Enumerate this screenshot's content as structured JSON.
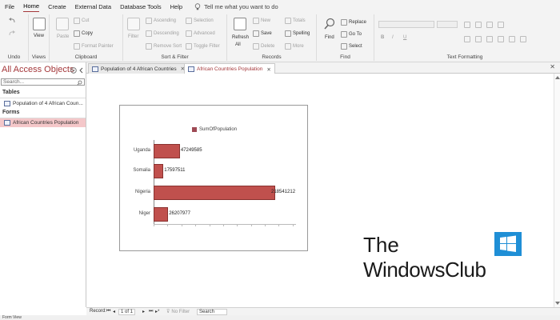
{
  "menu": {
    "tabs": [
      "File",
      "Home",
      "Create",
      "External Data",
      "Database Tools",
      "Help"
    ],
    "active": "Home",
    "tell_me": "Tell me what you want to do"
  },
  "ribbon": {
    "undo": {
      "label": "Undo"
    },
    "views": {
      "label": "Views",
      "view": "View"
    },
    "clipboard": {
      "label": "Clipboard",
      "paste": "Paste",
      "cut": "Cut",
      "copy": "Copy",
      "format_painter": "Format Painter"
    },
    "sort_filter": {
      "label": "Sort & Filter",
      "filter": "Filter",
      "ascending": "Ascending",
      "descending": "Descending",
      "remove_sort": "Remove Sort",
      "selection": "Selection",
      "advanced": "Advanced",
      "toggle_filter": "Toggle Filter"
    },
    "records": {
      "label": "Records",
      "refresh": "Refresh",
      "all": "All",
      "new": "New",
      "save": "Save",
      "delete": "Delete",
      "totals": "Totals",
      "spelling": "Spelling",
      "more": "More"
    },
    "find": {
      "label": "Find",
      "find": "Find",
      "replace": "Replace",
      "goto": "Go To",
      "select": "Select"
    },
    "text_formatting": {
      "label": "Text Formatting",
      "bold": "B",
      "italic": "I",
      "underline": "U"
    }
  },
  "nav": {
    "title": "All Access Objects",
    "search_placeholder": "Search...",
    "sections": [
      {
        "name": "Tables",
        "items": [
          "Population of 4 African Coun..."
        ]
      },
      {
        "name": "Forms",
        "items": [
          "African Countries Population"
        ]
      }
    ]
  },
  "doc_tabs": [
    {
      "label": "Population of 4 African Countries",
      "active": false
    },
    {
      "label": "African Countries Population",
      "active": true
    }
  ],
  "chart_data": {
    "type": "bar",
    "orientation": "horizontal",
    "categories": [
      "Uganda",
      "Somalia",
      "Nigeria",
      "Niger"
    ],
    "series": [
      {
        "name": "SumOfPopulation",
        "values": [
          47249585,
          17597511,
          218541212,
          26207977
        ],
        "color": "#c0504d"
      }
    ],
    "value_labels": [
      "47249585",
      "17597511",
      "218541212",
      "26207977"
    ],
    "xlim": [
      0,
      250000000
    ],
    "legend_position": "top",
    "grid": false
  },
  "watermark": {
    "line1": "The",
    "line2": "WindowsClub"
  },
  "record_nav": {
    "label": "Record:",
    "position": "1 of 1",
    "no_filter": "No Filter",
    "search": "Search"
  },
  "status": {
    "text": "Form View"
  },
  "colors": {
    "accent": "#a4373a",
    "bar": "#c0504d",
    "selection": "#f4c7c9"
  }
}
